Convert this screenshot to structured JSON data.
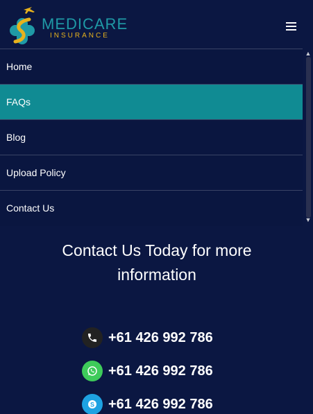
{
  "brand": {
    "name": "MEDICARE",
    "tagline": "INSURANCE",
    "colors": {
      "primary": "#1f9aa6",
      "accent": "#e7b21d",
      "background": "#0b1742"
    }
  },
  "header": {
    "menu_icon": "hamburger-icon"
  },
  "nav": {
    "items": [
      {
        "label": "Home",
        "active": false
      },
      {
        "label": "FAQs",
        "active": true
      },
      {
        "label": "Blog",
        "active": false
      },
      {
        "label": "Upload Policy",
        "active": false
      },
      {
        "label": "Contact Us",
        "active": false
      }
    ],
    "active_color": "#108b93"
  },
  "contact": {
    "title": "Contact Us Today for more information",
    "channels": [
      {
        "icon": "phone-icon",
        "number": "+61 426 992 786",
        "color": "#222222"
      },
      {
        "icon": "whatsapp-icon",
        "number": "+61 426 992 786",
        "color": "#3ecb5a"
      },
      {
        "icon": "skype-icon",
        "number": "+61 426 992 786",
        "color": "#1ea2e2"
      }
    ]
  }
}
